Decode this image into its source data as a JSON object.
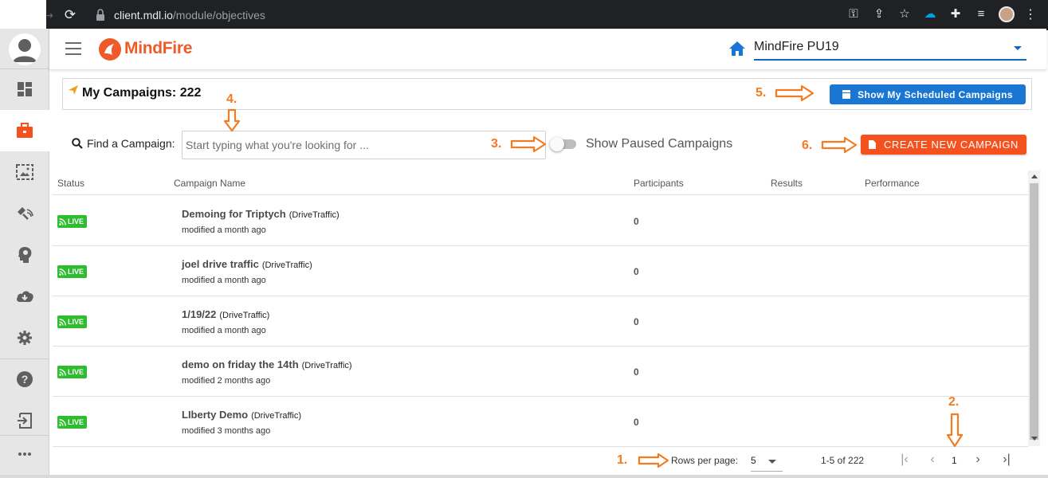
{
  "browser": {
    "url_host": "client.mdl.io",
    "url_path": "/module/objectives"
  },
  "header": {
    "logo_text": "MindFire",
    "account_name": "MindFire PU19"
  },
  "campaigns": {
    "title": "My Campaigns: 222",
    "scheduled_button": "Show My Scheduled Campaigns",
    "find_label": "Find a Campaign:",
    "search_placeholder": "Start typing what you're looking for ...",
    "paused_toggle_label": "Show Paused Campaigns",
    "create_button": "CREATE NEW CAMPAIGN"
  },
  "table": {
    "columns": [
      "Status",
      "Campaign Name",
      "Participants",
      "Results",
      "Performance"
    ],
    "rows": [
      {
        "status": "LIVE",
        "name": "Demoing for Triptych",
        "type": "(DriveTraffic)",
        "modified": "modified a month ago",
        "participants": "0"
      },
      {
        "status": "LIVE",
        "name": "joel drive traffic",
        "type": "(DriveTraffic)",
        "modified": "modified a month ago",
        "participants": "0"
      },
      {
        "status": "LIVE",
        "name": "1/19/22",
        "type": "(DriveTraffic)",
        "modified": "modified a month ago",
        "participants": "0"
      },
      {
        "status": "LIVE",
        "name": "demo on friday the 14th",
        "type": "(DriveTraffic)",
        "modified": "modified 2 months ago",
        "participants": "0"
      },
      {
        "status": "LIVE",
        "name": "LIberty Demo",
        "type": "(DriveTraffic)",
        "modified": "modified 3 months ago",
        "participants": "0"
      }
    ]
  },
  "pagination": {
    "rows_per_page_label": "Rows per page:",
    "rows_per_page_value": "5",
    "range": "1-5 of 222",
    "current_page": "1"
  },
  "annotations": {
    "n1": "1.",
    "n2": "2.",
    "n3": "3.",
    "n4": "4.",
    "n5": "5.",
    "n6": "6."
  },
  "colors": {
    "brand_orange": "#f4511e",
    "primary_blue": "#1976d2",
    "live_green": "#2ebd2e",
    "annotation_orange": "#f47b20"
  },
  "sidebar_icons": [
    "dashboard-icon",
    "briefcase-icon",
    "image-icon",
    "satellite-icon",
    "lightbulb-head-icon",
    "cloud-download-icon",
    "gear-icon",
    "help-icon",
    "logout-icon",
    "more-icon"
  ]
}
